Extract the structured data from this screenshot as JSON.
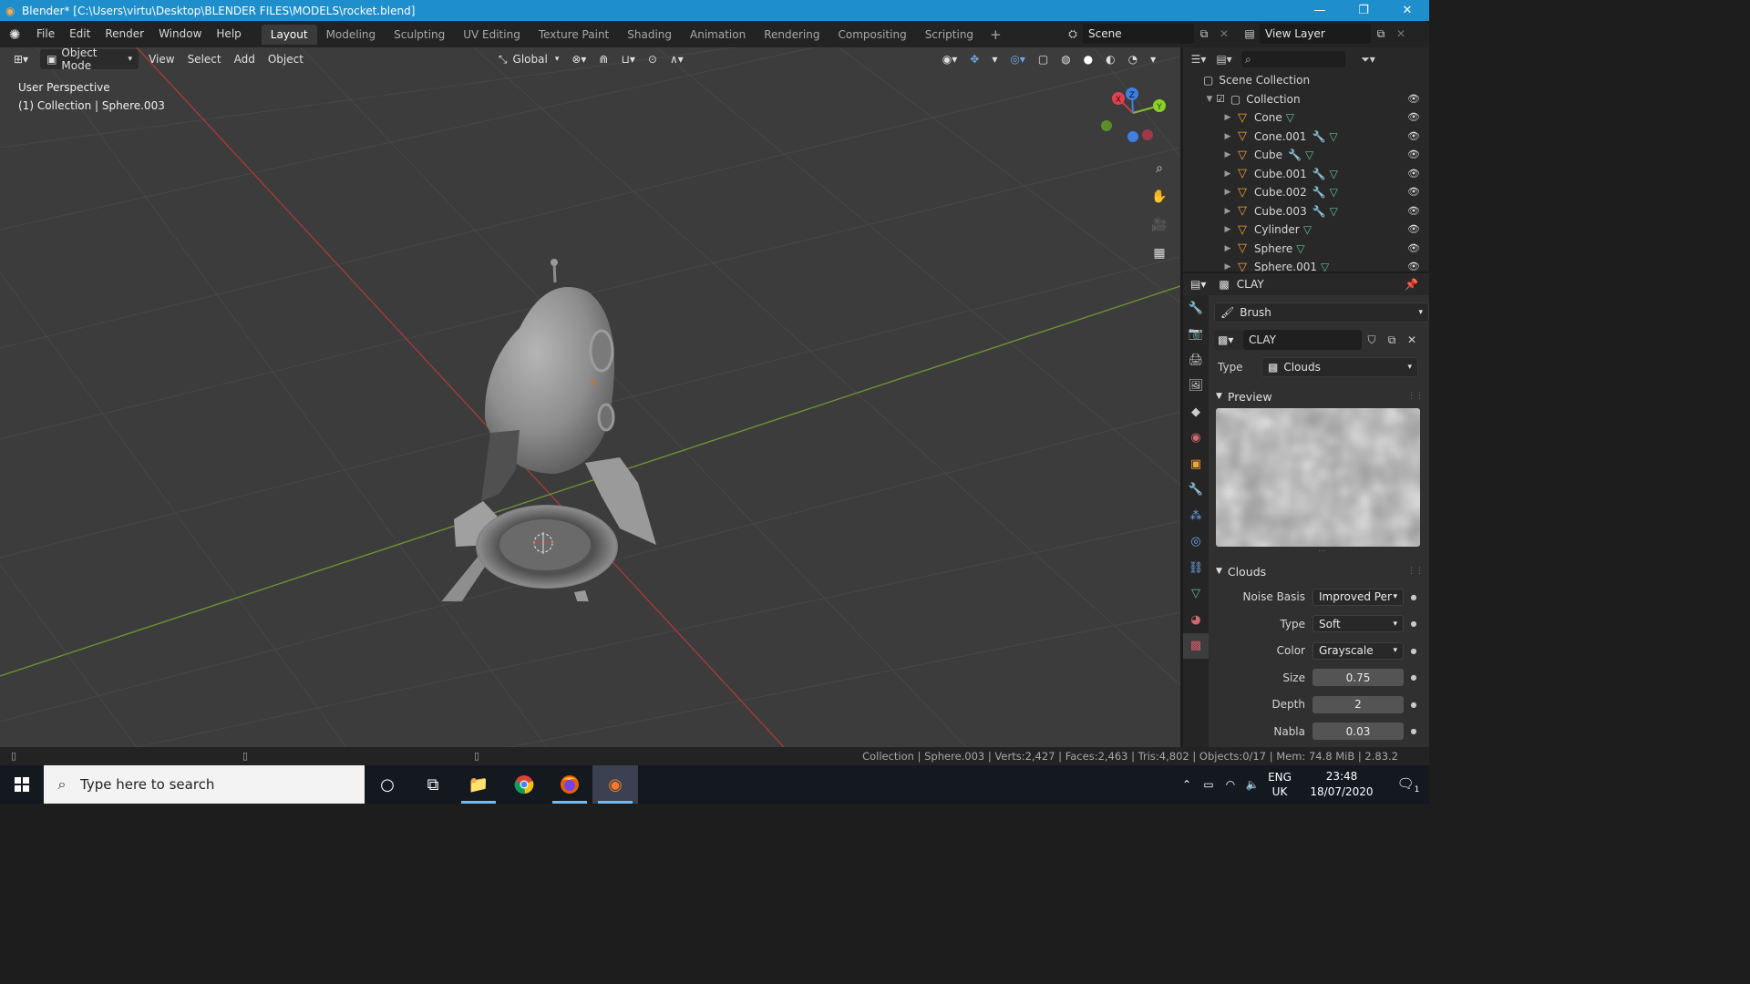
{
  "window": {
    "title": "Blender* [C:\\Users\\virtu\\Desktop\\BLENDER FILES\\MODELS\\rocket.blend]",
    "controls": [
      "—",
      "❐",
      "✕"
    ]
  },
  "menu": {
    "items": [
      "File",
      "Edit",
      "Render",
      "Window",
      "Help"
    ]
  },
  "workspaces": {
    "tabs": [
      "Layout",
      "Modeling",
      "Sculpting",
      "UV Editing",
      "Texture Paint",
      "Shading",
      "Animation",
      "Rendering",
      "Compositing",
      "Scripting"
    ],
    "active": "Layout",
    "add": "+"
  },
  "scene": {
    "name": "Scene",
    "view_layer": "View Layer"
  },
  "viewport_header": {
    "mode": "Object Mode",
    "menus": [
      "View",
      "Select",
      "Add",
      "Object"
    ],
    "orientation": "Global"
  },
  "viewport": {
    "perspective": "User Perspective",
    "collection_info": "(1) Collection | Sphere.003",
    "gizmo": {
      "x": "X",
      "y": "Y",
      "z": "Z"
    }
  },
  "outliner": {
    "root": "Scene Collection",
    "collection": "Collection",
    "objects": [
      {
        "name": "Cone",
        "modifier": false
      },
      {
        "name": "Cone.001",
        "modifier": true
      },
      {
        "name": "Cube",
        "modifier": true
      },
      {
        "name": "Cube.001",
        "modifier": true
      },
      {
        "name": "Cube.002",
        "modifier": true
      },
      {
        "name": "Cube.003",
        "modifier": true
      },
      {
        "name": "Cylinder",
        "modifier": false
      },
      {
        "name": "Sphere",
        "modifier": false
      },
      {
        "name": "Sphere.001",
        "modifier": false
      }
    ]
  },
  "properties": {
    "header_name": "CLAY",
    "context": "Brush",
    "texture_name": "CLAY",
    "type_label": "Type",
    "type_value": "Clouds",
    "preview_label": "Preview",
    "clouds_label": "Clouds",
    "fields": [
      {
        "label": "Noise Basis",
        "value": "Improved Perlin",
        "kind": "select"
      },
      {
        "label": "Type",
        "value": "Soft",
        "kind": "select"
      },
      {
        "label": "Color",
        "value": "Grayscale",
        "kind": "select"
      },
      {
        "label": "Size",
        "value": "0.75",
        "kind": "num"
      },
      {
        "label": "Depth",
        "value": "2",
        "kind": "num"
      },
      {
        "label": "Nabla",
        "value": "0.03",
        "kind": "num"
      }
    ]
  },
  "statusbar": {
    "stats": "Collection | Sphere.003 | Verts:2,427 | Faces:2,463 | Tris:4,802 | Objects:0/17 | Mem: 74.8 MiB | 2.83.2"
  },
  "taskbar": {
    "search_placeholder": "Type here to search",
    "lang_top": "ENG",
    "lang_bottom": "UK",
    "time": "23:48",
    "date": "18/07/2020",
    "notification_count": "1"
  },
  "colors": {
    "titlebar": "#1e8fcc",
    "x_axis": "#b03a3a",
    "y_axis": "#7fa03a",
    "object_icon": "#f1a239"
  }
}
